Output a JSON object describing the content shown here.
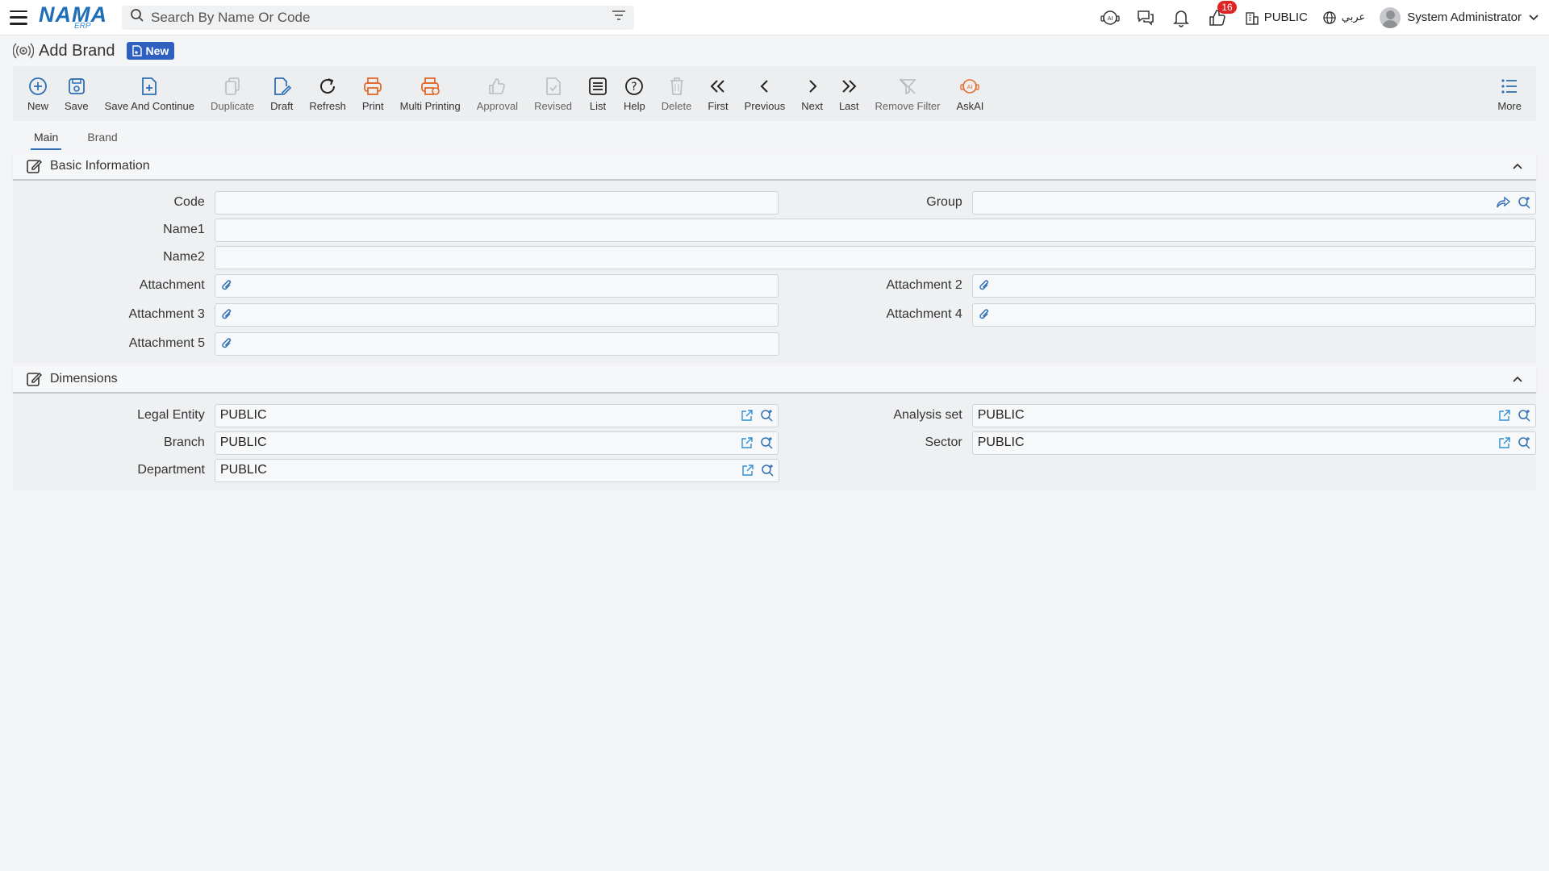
{
  "topbar": {
    "logo_text": "NAMA",
    "logo_sub": "ERP",
    "search_placeholder": "Search By Name Or Code",
    "notification_badge": "16",
    "org_label": "PUBLIC",
    "language_label": "عربي",
    "user_name": "System Administrator"
  },
  "page": {
    "title": "Add Brand",
    "status_badge": "New"
  },
  "toolbar": {
    "items": [
      {
        "label": "New",
        "icon": "plus-circle-icon"
      },
      {
        "label": "Save",
        "icon": "save-icon"
      },
      {
        "label": "Save And Continue",
        "icon": "doc-plus-icon"
      },
      {
        "label": "Duplicate",
        "icon": "duplicate-icon"
      },
      {
        "label": "Draft",
        "icon": "draft-icon"
      },
      {
        "label": "Refresh",
        "icon": "refresh-icon"
      },
      {
        "label": "Print",
        "icon": "print-icon"
      },
      {
        "label": "Multi Printing",
        "icon": "multi-print-icon"
      },
      {
        "label": "Approval",
        "icon": "thumbs-up-icon"
      },
      {
        "label": "Revised",
        "icon": "revised-icon"
      },
      {
        "label": "List",
        "icon": "list-icon"
      },
      {
        "label": "Help",
        "icon": "help-icon"
      },
      {
        "label": "Delete",
        "icon": "trash-icon"
      },
      {
        "label": "First",
        "icon": "double-chevron-left-icon"
      },
      {
        "label": "Previous",
        "icon": "chevron-left-icon"
      },
      {
        "label": "Next",
        "icon": "chevron-right-icon"
      },
      {
        "label": "Last",
        "icon": "double-chevron-right-icon"
      },
      {
        "label": "Remove Filter",
        "icon": "remove-filter-icon"
      },
      {
        "label": "AskAI",
        "icon": "ai-icon"
      }
    ],
    "more_label": "More"
  },
  "tabs": [
    {
      "label": "Main",
      "active": true
    },
    {
      "label": "Brand",
      "active": false
    }
  ],
  "basic_info": {
    "title": "Basic Information",
    "code_label": "Code",
    "code_value": "",
    "group_label": "Group",
    "group_value": "",
    "name1_label": "Name1",
    "name1_value": "",
    "name2_label": "Name2",
    "name2_value": "",
    "attachment_label": "Attachment",
    "attachment2_label": "Attachment 2",
    "attachment3_label": "Attachment 3",
    "attachment4_label": "Attachment 4",
    "attachment5_label": "Attachment 5"
  },
  "dimensions": {
    "title": "Dimensions",
    "legal_entity_label": "Legal Entity",
    "legal_entity_value": "PUBLIC",
    "analysis_set_label": "Analysis set",
    "analysis_set_value": "PUBLIC",
    "branch_label": "Branch",
    "branch_value": "PUBLIC",
    "sector_label": "Sector",
    "sector_value": "PUBLIC",
    "department_label": "Department",
    "department_value": "PUBLIC"
  },
  "colors": {
    "primary_blue": "#2f6fb5",
    "print_orange": "#e06a2b",
    "disabled_gray": "#b8bcc2",
    "badge_red": "#e02424",
    "new_badge": "#2f5fbf"
  }
}
